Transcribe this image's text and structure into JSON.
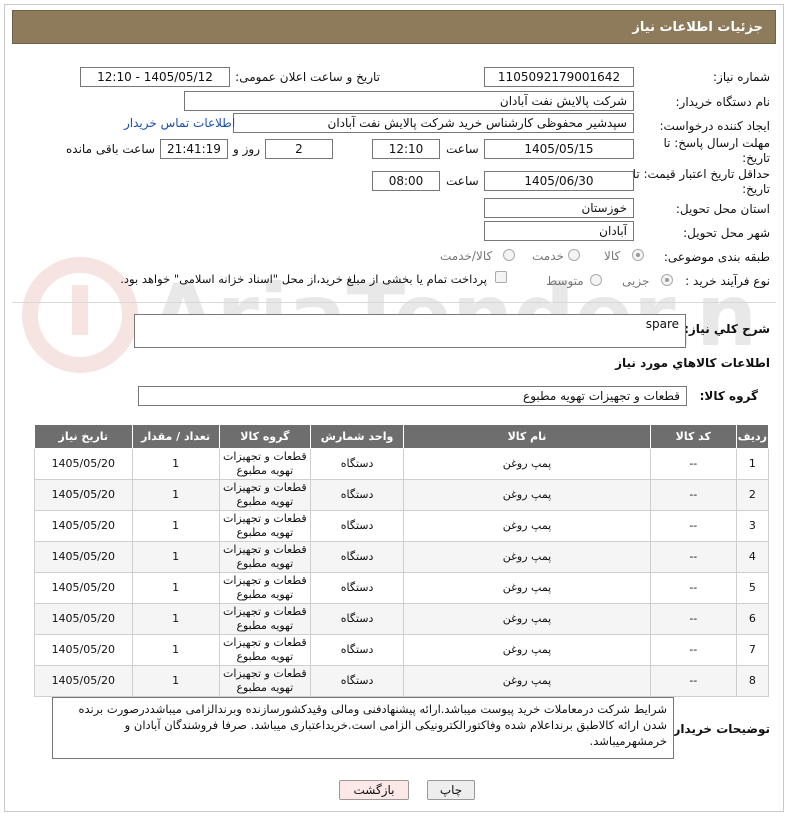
{
  "header": {
    "title": "جزئیات اطلاعات نیاز"
  },
  "labels": {
    "need_number": "شماره نیاز:",
    "announce_datetime": "تاریخ و ساعت اعلان عمومی:",
    "buyer_org": "نام دستگاه خریدار:",
    "requester": "ایجاد کننده درخواست:",
    "buyer_contact": "اطلاعات تماس خریدار",
    "reply_deadline": "مهلت ارسال پاسخ: تا تاریخ:",
    "time_word": "ساعت",
    "day_word": "روز و",
    "remaining": "ساعت باقی مانده",
    "price_validity": "حداقل تاریخ اعتبار قیمت: تا تاریخ:",
    "province": "استان محل تحویل:",
    "city": "شهر محل تحویل:",
    "category": "طبقه بندی موضوعی:",
    "process_type": "نوع فرآیند خرید :",
    "need_summary": "شرح كلي نياز:",
    "goods_info": "اطلاعات كالاهاي مورد نياز",
    "goods_group": "گروه کالا:",
    "buyer_notes": "توضیحات خریدار:"
  },
  "values": {
    "need_number": "1105092179001642",
    "announce_datetime": "1405/05/12 - 12:10",
    "buyer_org": "شرکت پالایش نفت آبادان",
    "requester": "سپدشیر محفوظی کارشناس خرید  شرکت پالایش نفت آبادان",
    "reply_date": "1405/05/15",
    "reply_time": "12:10",
    "reply_days": "2",
    "reply_remaining": "21:41:19",
    "price_date": "1405/06/30",
    "price_time": "08:00",
    "province": "خوزستان",
    "city": "آبادان",
    "need_summary": "spare",
    "goods_group": "قطعات و تجهیزات تهویه مطبوع",
    "buyer_notes": "شرایط شرکت درمعاملات خرید پیوست میباشد.ارائه پیشنهادفنی ومالی وقیدکشورسازنده وبرندالزامی میباشددرصورت برنده شدن ارائه کالاطبق برنداعلام شده وفاکتورالکترونیکی الزامی است.خریداعتباری میباشد. صرفا فروشندگان آبادان و خرمشهرمیباشد."
  },
  "category_options": [
    {
      "label": "کالا",
      "selected": true
    },
    {
      "label": "خدمت",
      "selected": false
    },
    {
      "label": "کالا/خدمت",
      "selected": false
    }
  ],
  "process_options": [
    {
      "label": "جزیی",
      "selected": true
    },
    {
      "label": "متوسط",
      "selected": false
    }
  ],
  "treasury_note": "پرداخت تمام یا بخشی از مبلغ خرید،از محل \"اسناد خزانه اسلامی\" خواهد بود.",
  "table": {
    "headers": [
      "ردیف",
      "کد کالا",
      "نام کالا",
      "واحد شمارش",
      "گروه کالا",
      "تعداد / مقدار",
      "تاریخ نیاز"
    ],
    "rows": [
      [
        "1",
        "--",
        "پمپ روغن",
        "دستگاه",
        "قطعات و تجهیزات تهویه مطبوع",
        "1",
        "1405/05/20"
      ],
      [
        "2",
        "--",
        "پمپ روغن",
        "دستگاه",
        "قطعات و تجهیزات تهویه مطبوع",
        "1",
        "1405/05/20"
      ],
      [
        "3",
        "--",
        "پمپ روغن",
        "دستگاه",
        "قطعات و تجهیزات تهویه مطبوع",
        "1",
        "1405/05/20"
      ],
      [
        "4",
        "--",
        "پمپ روغن",
        "دستگاه",
        "قطعات و تجهیزات تهویه مطبوع",
        "1",
        "1405/05/20"
      ],
      [
        "5",
        "--",
        "پمپ روغن",
        "دستگاه",
        "قطعات و تجهیزات تهویه مطبوع",
        "1",
        "1405/05/20"
      ],
      [
        "6",
        "--",
        "پمپ روغن",
        "دستگاه",
        "قطعات و تجهیزات تهویه مطبوع",
        "1",
        "1405/05/20"
      ],
      [
        "7",
        "--",
        "پمپ روغن",
        "دستگاه",
        "قطعات و تجهیزات تهویه مطبوع",
        "1",
        "1405/05/20"
      ],
      [
        "8",
        "--",
        "پمپ روغن",
        "دستگاه",
        "قطعات و تجهیزات تهویه مطبوع",
        "1",
        "1405/05/20"
      ]
    ]
  },
  "buttons": {
    "print": "چاپ",
    "back": "بازگشت"
  },
  "watermark_text": "AriaTender.neT",
  "colors": {
    "header_bg": "#8d7b5b",
    "table_header_bg": "#6e6e6e",
    "link": "#1a4fa8",
    "watermark": "#c0392b"
  }
}
